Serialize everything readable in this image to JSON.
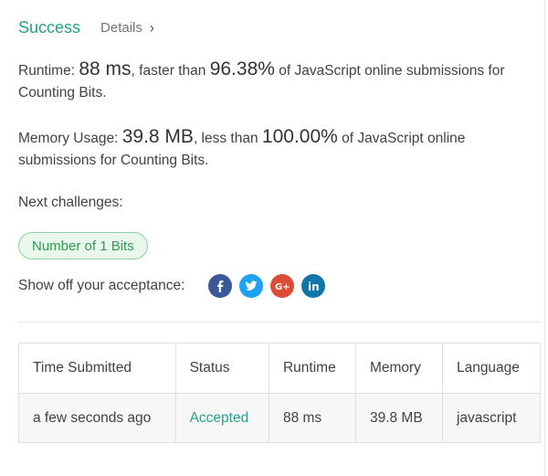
{
  "header": {
    "status": "Success",
    "details_label": "Details",
    "details_chevron": "›"
  },
  "runtime": {
    "label": "Runtime:",
    "value": "88 ms",
    "comparison_text": ", faster than",
    "percentile": "96.38%",
    "suffix": "of JavaScript online submissions for Counting Bits."
  },
  "memory": {
    "label": "Memory Usage:",
    "value": "39.8 MB",
    "comparison_text": ", less than",
    "percentile": "100.00%",
    "suffix": "of JavaScript online submissions for Counting Bits."
  },
  "next": {
    "label": "Next challenges:",
    "challenge": "Number of 1 Bits"
  },
  "share": {
    "label": "Show off your acceptance:",
    "icons": [
      "facebook-icon",
      "twitter-icon",
      "google-plus-icon",
      "linkedin-icon"
    ],
    "colors": {
      "facebook": "#3b5998",
      "twitter": "#1da1f2",
      "google_plus": "#dd4b39",
      "linkedin": "#0e76a8"
    }
  },
  "table": {
    "headers": [
      "Time Submitted",
      "Status",
      "Runtime",
      "Memory",
      "Language"
    ],
    "rows": [
      [
        "a few seconds ago",
        "Accepted",
        "88 ms",
        "39.8 MB",
        "javascript"
      ]
    ]
  },
  "colors": {
    "success": "#26a08c",
    "pill_border": "#8fd19e",
    "pill_bg": "#e9f7ec"
  }
}
